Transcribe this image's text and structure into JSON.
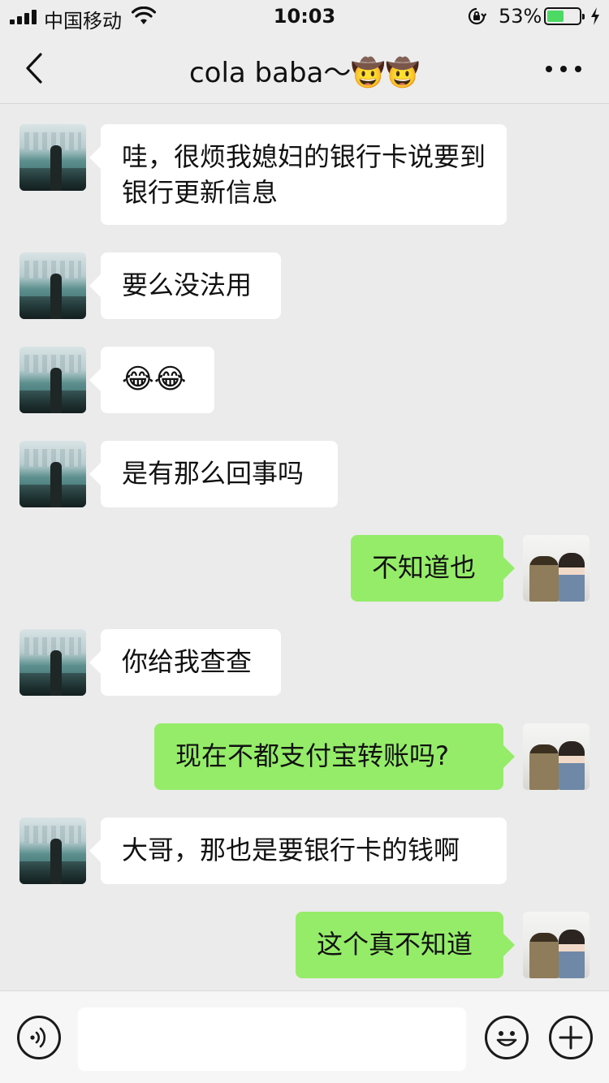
{
  "status_bar": {
    "carrier": "中国移动",
    "time": "10:03",
    "battery_percent": "53%",
    "battery_level": 0.53,
    "icons": [
      "signal-icon",
      "wifi-icon",
      "orientation-lock-icon",
      "battery-icon",
      "charging-icon"
    ]
  },
  "nav": {
    "title": "cola baba～🤠🤠",
    "back_icon": "chevron-left-icon",
    "more_icon": "more-dots-icon"
  },
  "messages": [
    {
      "from": "friend",
      "text": "哇，很烦我媳妇的银行卡说要到银行更新信息"
    },
    {
      "from": "friend",
      "text": "要么没法用"
    },
    {
      "from": "friend",
      "text": "😂😂"
    },
    {
      "from": "friend",
      "text": "是有那么回事吗"
    },
    {
      "from": "me",
      "text": "不知道也"
    },
    {
      "from": "friend",
      "text": "你给我查查"
    },
    {
      "from": "me",
      "text": "现在不都支付宝转账吗?"
    },
    {
      "from": "friend",
      "text": "大哥，那也是要银行卡的钱啊"
    },
    {
      "from": "me",
      "text": "这个真不知道"
    }
  ],
  "input_bar": {
    "value": "",
    "icons": [
      "voice-icon",
      "emoji-icon",
      "plus-icon"
    ]
  },
  "colors": {
    "background": "#ebebeb",
    "bubble_in": "#ffffff",
    "bubble_out": "#95ec69",
    "battery_fill": "#4cd964"
  }
}
